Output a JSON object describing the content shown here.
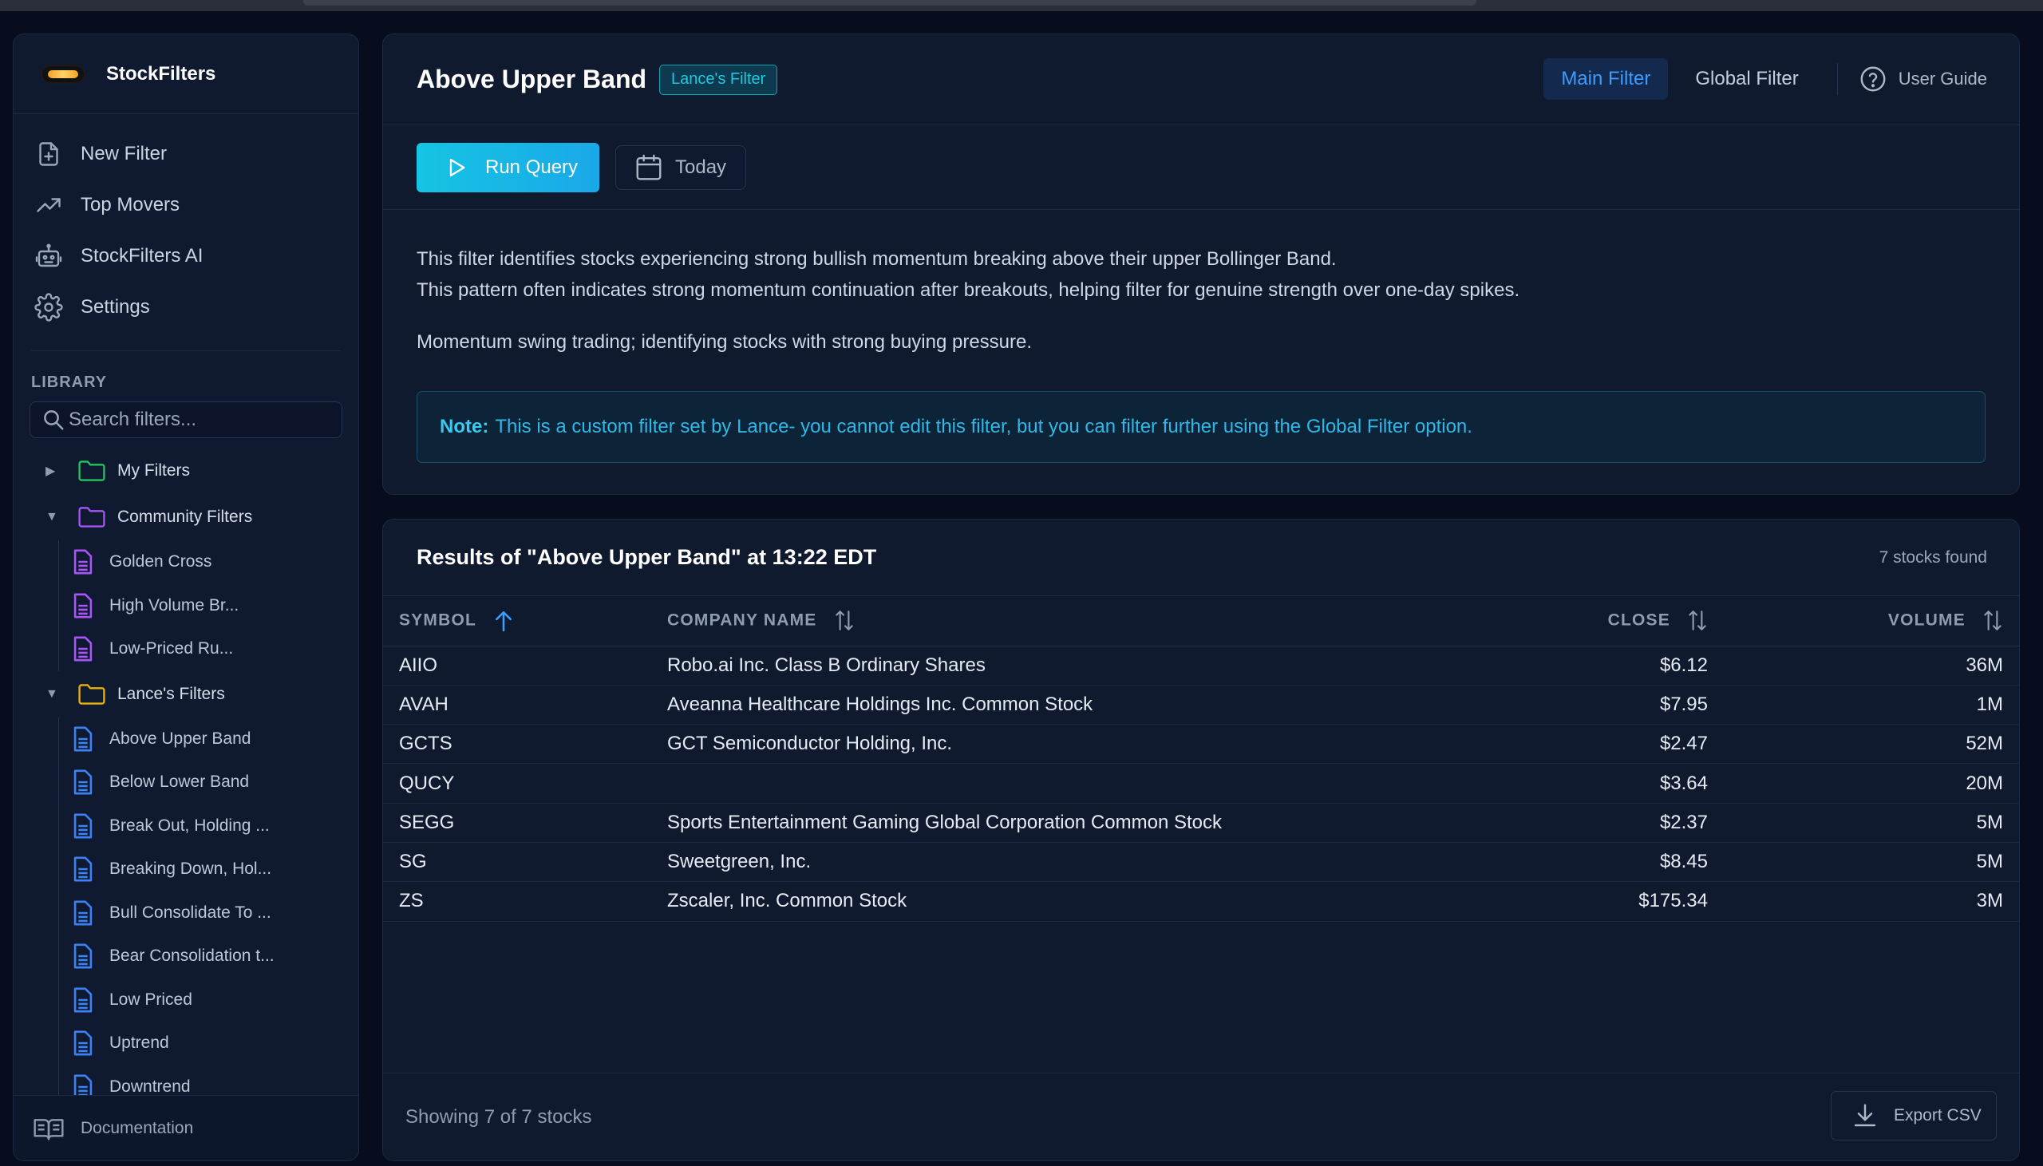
{
  "app": {
    "name": "StockFilters"
  },
  "nav": [
    {
      "label": "New Filter",
      "icon": "file-plus-icon"
    },
    {
      "label": "Top Movers",
      "icon": "trending-up-icon"
    },
    {
      "label": "StockFilters AI",
      "icon": "robot-icon"
    },
    {
      "label": "Settings",
      "icon": "gear-icon"
    }
  ],
  "library": {
    "title": "LIBRARY",
    "search_placeholder": "Search filters...",
    "folders": [
      {
        "label": "My Filters",
        "expanded": false,
        "color": "#22c55e",
        "items": []
      },
      {
        "label": "Community Filters",
        "expanded": true,
        "color": "#a855f7",
        "items": [
          "Golden Cross",
          "High Volume Br...",
          "Low-Priced Ru..."
        ]
      },
      {
        "label": "Lance's Filters",
        "expanded": true,
        "color": "#eab308",
        "items": [
          "Above Upper Band",
          "Below Lower Band",
          "Break Out, Holding ...",
          "Breaking Down, Hol...",
          "Bull Consolidate To ...",
          "Bear Consolidation t...",
          "Low Priced",
          "Uptrend",
          "Downtrend"
        ]
      }
    ]
  },
  "footer": {
    "docs_label": "Documentation"
  },
  "filter": {
    "title": "Above Upper Band",
    "badge": "Lance's Filter",
    "tabs": {
      "main": "Main Filter",
      "global": "Global Filter"
    },
    "guide_label": "User Guide",
    "run_label": "Run Query",
    "date_label": "Today",
    "desc_line1": "This filter identifies stocks experiencing strong bullish momentum breaking above their upper Bollinger Band.",
    "desc_line2": "This pattern often indicates strong momentum continuation after breakouts, helping filter for genuine strength over one-day spikes.",
    "desc_line3": "Momentum swing trading; identifying stocks with strong buying pressure.",
    "note_label": "Note:",
    "note_text": "This is a custom filter set by Lance- you cannot edit this filter, but you can filter further using the Global Filter option."
  },
  "results": {
    "title": "Results of \"Above Upper Band\" at 13:22 EDT",
    "count": "7 stocks found",
    "columns": {
      "symbol": "SYMBOL",
      "company": "COMPANY NAME",
      "close": "CLOSE",
      "volume": "VOLUME"
    },
    "rows": [
      {
        "symbol": "AIIO",
        "company": "Robo.ai Inc. Class B Ordinary Shares",
        "close": "$6.12",
        "volume": "36M"
      },
      {
        "symbol": "AVAH",
        "company": "Aveanna Healthcare Holdings Inc. Common Stock",
        "close": "$7.95",
        "volume": "1M"
      },
      {
        "symbol": "GCTS",
        "company": "GCT Semiconductor Holding, Inc.",
        "close": "$2.47",
        "volume": "52M"
      },
      {
        "symbol": "QUCY",
        "company": "",
        "close": "$3.64",
        "volume": "20M"
      },
      {
        "symbol": "SEGG",
        "company": "Sports Entertainment Gaming Global Corporation Common Stock",
        "close": "$2.37",
        "volume": "5M"
      },
      {
        "symbol": "SG",
        "company": "Sweetgreen, Inc.",
        "close": "$8.45",
        "volume": "5M"
      },
      {
        "symbol": "ZS",
        "company": "Zscaler, Inc. Common Stock",
        "close": "$175.34",
        "volume": "3M"
      }
    ],
    "showing": "Showing 7 of 7 stocks",
    "export_label": "Export CSV"
  },
  "colors": {
    "accent": "#16c4e3",
    "link": "#3d9cff",
    "background": "#070d1c",
    "panel": "#101a2f"
  }
}
